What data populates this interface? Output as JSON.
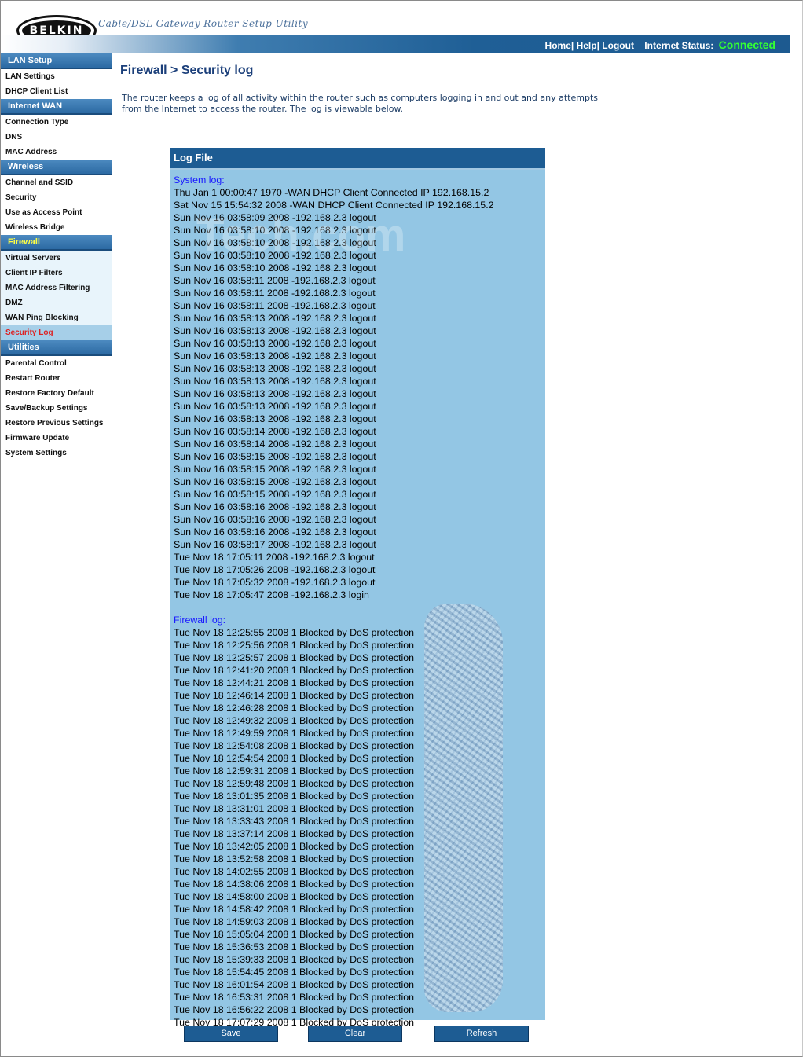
{
  "header": {
    "logo": "BELKIN",
    "tagline": "Cable/DSL Gateway Router Setup Utility",
    "links": {
      "home": "Home",
      "help": "Help",
      "logout": "Logout"
    },
    "status_label": "Internet Status:",
    "status_value": "Connected",
    "status_color": "#33ff33"
  },
  "sidebar": {
    "sections": [
      {
        "label": "LAN Setup",
        "items": [
          "LAN Settings",
          "DHCP Client List"
        ]
      },
      {
        "label": "Internet WAN",
        "items": [
          "Connection Type",
          "DNS",
          "MAC Address"
        ]
      },
      {
        "label": "Wireless",
        "items": [
          "Channel and SSID",
          "Security",
          "Use as Access Point",
          "Wireless Bridge"
        ]
      },
      {
        "label": "Firewall",
        "items": [
          "Virtual Servers",
          "Client IP Filters",
          "MAC Address Filtering",
          "DMZ",
          "WAN Ping Blocking",
          "Security Log"
        ]
      },
      {
        "label": "Utilities",
        "items": [
          "Parental Control",
          "Restart Router",
          "Restore Factory Default",
          "Save/Backup Settings",
          "Restore Previous Settings",
          "Firmware Update",
          "System Settings"
        ]
      }
    ],
    "active_item": "Security Log"
  },
  "main": {
    "title": "Firewall > Security log",
    "intro": "The router keeps a log of all activity within the router such as computers logging in and out and any attempts from the Internet to access the router. The log is viewable below."
  },
  "log": {
    "header": "Log File",
    "system_label": "System log:",
    "system_lines": [
      "Thu Jan 1 00:00:47 1970 -WAN DHCP Client Connected IP 192.168.15.2",
      "Sat Nov 15 15:54:32 2008 -WAN DHCP Client Connected IP 192.168.15.2",
      "Sun Nov 16 03:58:09 2008 -192.168.2.3 logout",
      "Sun Nov 16 03:58:10 2008 -192.168.2.3 logout",
      "Sun Nov 16 03:58:10 2008 -192.168.2.3 logout",
      "Sun Nov 16 03:58:10 2008 -192.168.2.3 logout",
      "Sun Nov 16 03:58:10 2008 -192.168.2.3 logout",
      "Sun Nov 16 03:58:11 2008 -192.168.2.3 logout",
      "Sun Nov 16 03:58:11 2008 -192.168.2.3 logout",
      "Sun Nov 16 03:58:11 2008 -192.168.2.3 logout",
      "Sun Nov 16 03:58:13 2008 -192.168.2.3 logout",
      "Sun Nov 16 03:58:13 2008 -192.168.2.3 logout",
      "Sun Nov 16 03:58:13 2008 -192.168.2.3 logout",
      "Sun Nov 16 03:58:13 2008 -192.168.2.3 logout",
      "Sun Nov 16 03:58:13 2008 -192.168.2.3 logout",
      "Sun Nov 16 03:58:13 2008 -192.168.2.3 logout",
      "Sun Nov 16 03:58:13 2008 -192.168.2.3 logout",
      "Sun Nov 16 03:58:13 2008 -192.168.2.3 logout",
      "Sun Nov 16 03:58:13 2008 -192.168.2.3 logout",
      "Sun Nov 16 03:58:14 2008 -192.168.2.3 logout",
      "Sun Nov 16 03:58:14 2008 -192.168.2.3 logout",
      "Sun Nov 16 03:58:15 2008 -192.168.2.3 logout",
      "Sun Nov 16 03:58:15 2008 -192.168.2.3 logout",
      "Sun Nov 16 03:58:15 2008 -192.168.2.3 logout",
      "Sun Nov 16 03:58:15 2008 -192.168.2.3 logout",
      "Sun Nov 16 03:58:16 2008 -192.168.2.3 logout",
      "Sun Nov 16 03:58:16 2008 -192.168.2.3 logout",
      "Sun Nov 16 03:58:16 2008 -192.168.2.3 logout",
      "Sun Nov 16 03:58:17 2008 -192.168.2.3 logout",
      "Tue Nov 18 17:05:11 2008 -192.168.2.3 logout",
      "Tue Nov 18 17:05:26 2008 -192.168.2.3 logout",
      "Tue Nov 18 17:05:32 2008 -192.168.2.3 logout",
      "Tue Nov 18 17:05:47 2008 -192.168.2.3 login"
    ],
    "firewall_label": "Firewall log:",
    "firewall_lines": [
      "Tue Nov 18 12:25:55 2008 1 Blocked by DoS protection",
      "Tue Nov 18 12:25:56 2008 1 Blocked by DoS protection",
      "Tue Nov 18 12:25:57 2008 1 Blocked by DoS protection",
      "Tue Nov 18 12:41:20 2008 1 Blocked by DoS protection",
      "Tue Nov 18 12:44:21 2008 1 Blocked by DoS protection",
      "Tue Nov 18 12:46:14 2008 1 Blocked by DoS protection",
      "Tue Nov 18 12:46:28 2008 1 Blocked by DoS protection",
      "Tue Nov 18 12:49:32 2008 1 Blocked by DoS protection",
      "Tue Nov 18 12:49:59 2008 1 Blocked by DoS protection",
      "Tue Nov 18 12:54:08 2008 1 Blocked by DoS protection",
      "Tue Nov 18 12:54:54 2008 1 Blocked by DoS protection",
      "Tue Nov 18 12:59:31 2008 1 Blocked by DoS protection",
      "Tue Nov 18 12:59:48 2008 1 Blocked by DoS protection",
      "Tue Nov 18 13:01:35 2008 1 Blocked by DoS protection",
      "Tue Nov 18 13:31:01 2008 1 Blocked by DoS protection",
      "Tue Nov 18 13:33:43 2008 1 Blocked by DoS protection",
      "Tue Nov 18 13:37:14 2008 1 Blocked by DoS protection",
      "Tue Nov 18 13:42:05 2008 1 Blocked by DoS protection",
      "Tue Nov 18 13:52:58 2008 1 Blocked by DoS protection",
      "Tue Nov 18 14:02:55 2008 1 Blocked by DoS protection",
      "Tue Nov 18 14:38:06 2008 1 Blocked by DoS protection",
      "Tue Nov 18 14:58:00 2008 1 Blocked by DoS protection",
      "Tue Nov 18 14:58:42 2008 1 Blocked by DoS protection",
      "Tue Nov 18 14:59:03 2008 1 Blocked by DoS protection",
      "Tue Nov 18 15:05:04 2008 1 Blocked by DoS protection",
      "Tue Nov 18 15:36:53 2008 1 Blocked by DoS protection",
      "Tue Nov 18 15:39:33 2008 1 Blocked by DoS protection",
      "Tue Nov 18 15:54:45 2008 1 Blocked by DoS protection",
      "Tue Nov 18 16:01:54 2008 1 Blocked by DoS protection",
      "Tue Nov 18 16:53:31 2008 1 Blocked by DoS protection",
      "Tue Nov 18 16:56:22 2008 1 Blocked by DoS protection",
      "Tue Nov 18 17:07:29 2008 1 Blocked by DoS protection"
    ]
  },
  "buttons": {
    "save": "Save",
    "clear": "Clear",
    "refresh": "Refresh"
  },
  "watermark": "Tech.com",
  "colors": {
    "nav_blue": "#1d5c93",
    "log_bg": "#93c6e4",
    "firewall_yellow": "#ffff44",
    "active_red": "#dd2222"
  }
}
